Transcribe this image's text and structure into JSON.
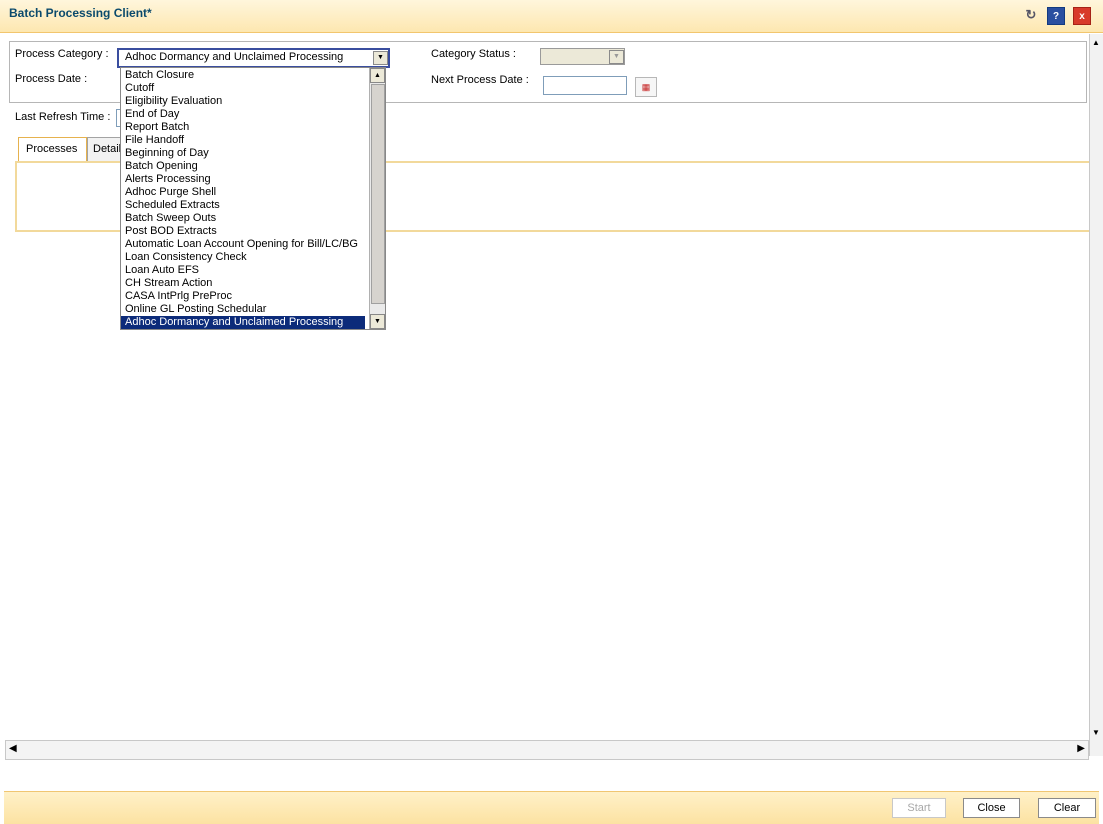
{
  "window": {
    "title": "Batch Processing Client*"
  },
  "title_icons": [
    "refresh-icon",
    "help-icon",
    "close-icon"
  ],
  "form": {
    "process_category_label": "Process Category :",
    "process_category_value": "Adhoc Dormancy and Unclaimed Processing",
    "process_date_label": "Process Date :",
    "category_status_label": "Category Status :",
    "next_process_date_label": "Next Process Date :",
    "last_refresh_label": "Last Refresh Time :"
  },
  "tabs": {
    "processes": "Processes",
    "details": "Details"
  },
  "dropdown": {
    "options": [
      "Batch Closure",
      "Cutoff",
      "Eligibility Evaluation",
      "End of Day",
      "Report Batch",
      "File Handoff",
      "Beginning of Day",
      "Batch Opening",
      "Alerts Processing",
      "Adhoc Purge Shell",
      "Scheduled Extracts",
      "Batch Sweep Outs",
      "Post BOD Extracts",
      "Automatic Loan Account Opening for Bill/LC/BG",
      "Loan Consistency Check",
      "Loan Auto EFS",
      "CH Stream Action",
      "CASA IntPrlg PreProc",
      "Online GL Posting Schedular",
      "Adhoc Dormancy and Unclaimed Processing"
    ],
    "selected": "Adhoc Dormancy and Unclaimed Processing"
  },
  "footer": {
    "start": "Start",
    "close": "Close",
    "clear": "Clear"
  },
  "colors": {
    "accent": "#0c2b7a",
    "header_bg": "#fde7b0"
  }
}
